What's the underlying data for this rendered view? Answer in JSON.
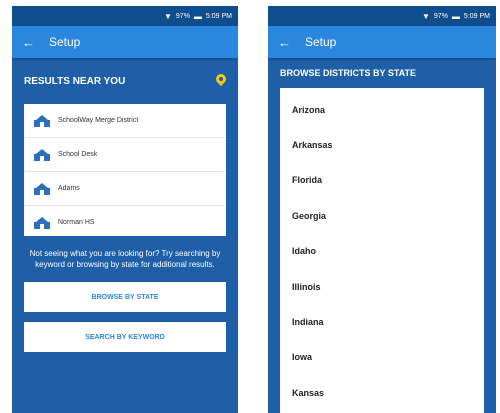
{
  "status_bar": {
    "signal": "97%",
    "time": "5:09 PM"
  },
  "left_screen": {
    "app_bar": {
      "title": "Setup"
    },
    "results_header": "RESULTS NEAR YOU",
    "results": [
      {
        "name": "SchoolWay Merge District"
      },
      {
        "name": "School Desk"
      },
      {
        "name": "Adams"
      },
      {
        "name": "Norman HS"
      }
    ],
    "help_text": "Not seeing what you are looking for? Try searching by keyword or browsing by state for additional results.",
    "browse_button": "BROWSE BY STATE",
    "search_button": "SEARCH BY KEYWORD"
  },
  "right_screen": {
    "app_bar": {
      "title": "Setup"
    },
    "header": "BROWSE DISTRICTS BY STATE",
    "states": [
      "Arizona",
      "Arkansas",
      "Florida",
      "Georgia",
      "Idaho",
      "Illinois",
      "Indiana",
      "Iowa",
      "Kansas"
    ]
  },
  "colors": {
    "primary": "#1e5fa8",
    "app_bar": "#2b87dd",
    "status_bar": "#0f4d8e",
    "accent_pin": "#f5c518"
  },
  "icons": {
    "back": "arrow-left-icon",
    "pin": "location-pin-icon",
    "school": "school-icon"
  }
}
